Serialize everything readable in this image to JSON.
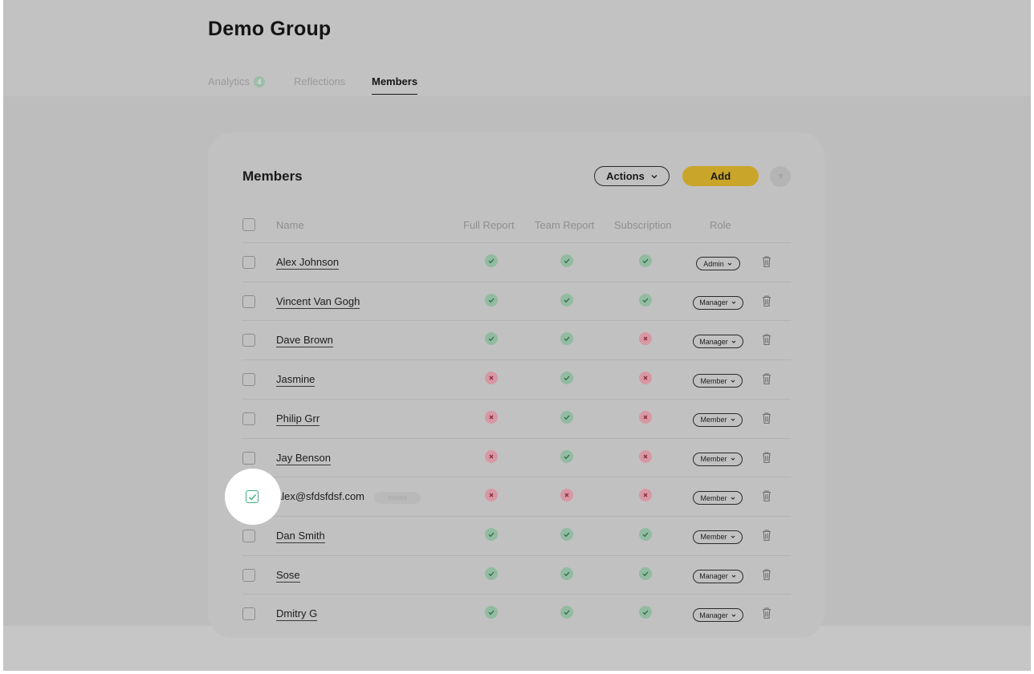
{
  "page": {
    "title": "Demo Group"
  },
  "tabs": [
    {
      "label": "Analytics",
      "badge": "4"
    },
    {
      "label": "Reflections"
    },
    {
      "label": "Members"
    }
  ],
  "members_card": {
    "title": "Members",
    "actions_label": "Actions",
    "add_label": "Add",
    "help_label": "?"
  },
  "table": {
    "columns": {
      "name": "Name",
      "full_report": "Full Report",
      "team_report": "Team Report",
      "subscription": "Subscription",
      "role": "Role"
    },
    "rows": [
      {
        "name": "Alex Johnson",
        "full_report": true,
        "team_report": true,
        "subscription": true,
        "role": "Admin",
        "checked": false,
        "invited": false
      },
      {
        "name": "Vincent Van Gogh",
        "full_report": true,
        "team_report": true,
        "subscription": true,
        "role": "Manager",
        "checked": false,
        "invited": false
      },
      {
        "name": "Dave Brown",
        "full_report": true,
        "team_report": true,
        "subscription": false,
        "role": "Manager",
        "checked": false,
        "invited": false
      },
      {
        "name": "Jasmine",
        "full_report": false,
        "team_report": true,
        "subscription": false,
        "role": "Member",
        "checked": false,
        "invited": false
      },
      {
        "name": "Philip Grr",
        "full_report": false,
        "team_report": true,
        "subscription": false,
        "role": "Member",
        "checked": false,
        "invited": false
      },
      {
        "name": "Jay Benson",
        "full_report": false,
        "team_report": true,
        "subscription": false,
        "role": "Member",
        "checked": false,
        "invited": false
      },
      {
        "name": "alex@sfdsfdsf.com",
        "full_report": false,
        "team_report": false,
        "subscription": false,
        "role": "Member",
        "checked": true,
        "invited": true,
        "invited_label": "Invited"
      },
      {
        "name": "Dan Smith",
        "full_report": true,
        "team_report": true,
        "subscription": true,
        "role": "Member",
        "checked": false,
        "invited": false
      },
      {
        "name": "Sose",
        "full_report": true,
        "team_report": true,
        "subscription": true,
        "role": "Manager",
        "checked": false,
        "invited": false
      },
      {
        "name": "Dmitry G",
        "full_report": true,
        "team_report": true,
        "subscription": true,
        "role": "Manager",
        "checked": false,
        "invited": false
      }
    ]
  },
  "icons": {
    "check": "check-icon",
    "cross": "cross-icon",
    "trash": "trash-icon",
    "chevron": "chevron-down-icon"
  },
  "colors": {
    "accent_add": "#c9a52a",
    "status_yes": "#92bba2",
    "status_no": "#d798a4",
    "checkbox_selected": "#3fae7d"
  }
}
